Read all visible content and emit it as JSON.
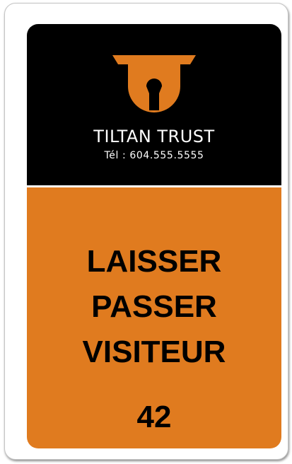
{
  "card": {
    "brand_name": "TILTAN TRUST",
    "phone": "Tél : 604.555.5555",
    "title_lines": [
      "LAISSER",
      "PASSER",
      "VISITEUR"
    ],
    "pass_number": "42"
  },
  "colors": {
    "header_background": "#000000",
    "accent_orange": "#e07b1f",
    "text_light": "#ffffff",
    "text_dark": "#000000"
  },
  "icons": {
    "logo": "tiltan-trust-logo-icon"
  }
}
